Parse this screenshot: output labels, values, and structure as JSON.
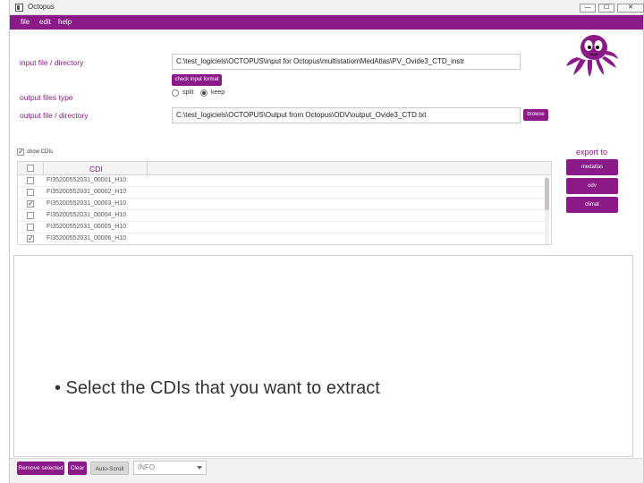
{
  "window": {
    "title": "Octopus",
    "controls": {
      "minimize": "—",
      "maximize": "☐",
      "close": "✕"
    }
  },
  "menubar": {
    "items": [
      "file",
      "edit",
      "help"
    ]
  },
  "input": {
    "label": "input file / directory",
    "value": "C:\\test_logiciels\\OCTOPUS\\input for Octopus\\multistation\\MedAtlas\\PV_Ovide3_CTD_instr",
    "check_button": "check input format"
  },
  "output_type": {
    "label": "output files type",
    "options": [
      {
        "label": "split",
        "selected": false
      },
      {
        "label": "keep",
        "selected": true
      }
    ]
  },
  "output": {
    "label": "output file / directory",
    "value": "C:\\test_logiciels\\OCTOPUS\\Output from Octopus\\ODV\\output_Ovide3_CTD.txt",
    "browse_button": "browse"
  },
  "show_cdis": {
    "label": "show CDIs",
    "checked": true
  },
  "table": {
    "column_header": "CDI",
    "rows": [
      {
        "value": "FI35200552031_00001_H10",
        "checked": false
      },
      {
        "value": "FI35200552031_00002_H10",
        "checked": false
      },
      {
        "value": "FI35200552031_00003_H10",
        "checked": true
      },
      {
        "value": "FI35200552031_00004_H10",
        "checked": false
      },
      {
        "value": "FI35200552031_00005_H10",
        "checked": false
      },
      {
        "value": "FI35200552031_00006_H10",
        "checked": true
      }
    ]
  },
  "export": {
    "title": "export to",
    "buttons": [
      "medatlas",
      "odv",
      "climat"
    ]
  },
  "caption": "• Select the CDIs that you want to extract",
  "bottom": {
    "remove_selected": "Remove selected",
    "clear": "Clear",
    "auto_scroll": "Auto-Scroll",
    "level": "INFO"
  },
  "colors": {
    "accent": "#8b1a88",
    "mascot": "#8b1a88"
  },
  "icons": {
    "mascot": "octopus-logo"
  }
}
